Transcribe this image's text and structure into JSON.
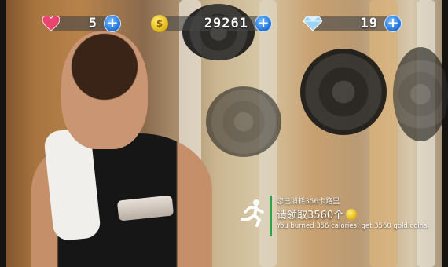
{
  "hud": {
    "lives": {
      "icon": "heart-icon",
      "value": "5",
      "add_icon": "plus-icon"
    },
    "coins": {
      "icon": "coin-icon",
      "value": "29261",
      "add_icon": "plus-icon"
    },
    "gems": {
      "icon": "diamond-icon",
      "value": "19",
      "add_icon": "plus-icon"
    }
  },
  "reward": {
    "icon": "running-person-icon",
    "line1": "您已消耗356卡路里",
    "line2_prefix": "请领取3560个",
    "line2_icon": "coin-icon",
    "line3": "You burned 356 calories, get 3560 gold coins."
  },
  "colors": {
    "accent_blue": "#1b6fd6",
    "divider_green": "#2ea34a",
    "coin_gold": "#e2b10d",
    "heart_pink": "#e9456f"
  }
}
